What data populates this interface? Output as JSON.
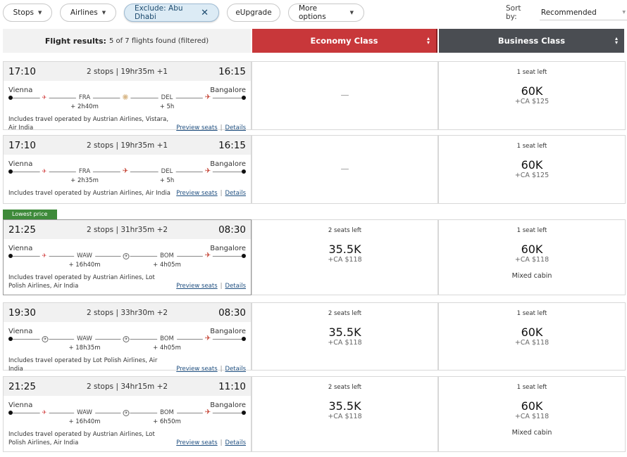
{
  "filters": {
    "stops": "Stops",
    "airlines": "Airlines",
    "exclude": "Exclude: Abu Dhabi",
    "eupgrade": "eUpgrade",
    "more": "More options"
  },
  "sort": {
    "label": "Sort by:",
    "value": "Recommended"
  },
  "header": {
    "results_label": "Flight results:",
    "results_text": "5 of 7 flights found (filtered)",
    "economy": "Economy Class",
    "business": "Business Class"
  },
  "links": {
    "preview": "Preview seats",
    "details": "Details",
    "sep": "|"
  },
  "lowest_badge": "Lowest price",
  "flights": [
    {
      "depart": "17:10",
      "summary": "2 stops | 19hr35m +1",
      "arrive": "16:15",
      "origin": "Vienna",
      "destination": "Bangalore",
      "stops": [
        {
          "code": "FRA",
          "layover": "+ 2h40m"
        },
        {
          "code": "DEL",
          "layover": "+ 5h"
        }
      ],
      "carriers": [
        "austrian-icon",
        "vistara-icon",
        "air-india-icon"
      ],
      "operated": "Includes travel operated by Austrian Airlines, Vistara, Air India",
      "economy": {
        "available": false,
        "dash": "—"
      },
      "business": {
        "seats": "1 seat left",
        "price": "60K",
        "tax": "+CA $125"
      }
    },
    {
      "depart": "17:10",
      "summary": "2 stops | 19hr35m +1",
      "arrive": "16:15",
      "origin": "Vienna",
      "destination": "Bangalore",
      "stops": [
        {
          "code": "FRA",
          "layover": "+ 2h35m"
        },
        {
          "code": "DEL",
          "layover": "+ 5h"
        }
      ],
      "carriers": [
        "austrian-icon",
        "air-india-icon",
        "air-india-icon"
      ],
      "operated": "Includes travel operated by Austrian Airlines, Air India",
      "economy": {
        "available": false,
        "dash": "—"
      },
      "business": {
        "seats": "1 seat left",
        "price": "60K",
        "tax": "+CA $125"
      }
    },
    {
      "depart": "21:25",
      "summary": "2 stops | 31hr35m +2",
      "arrive": "08:30",
      "origin": "Vienna",
      "destination": "Bangalore",
      "stops": [
        {
          "code": "WAW",
          "layover": "+ 16h40m"
        },
        {
          "code": "BOM",
          "layover": "+ 4h05m"
        }
      ],
      "carriers": [
        "austrian-icon",
        "lot-icon",
        "air-india-icon"
      ],
      "operated": "Includes travel operated by Austrian Airlines, Lot Polish Airlines, Air India",
      "economy": {
        "available": true,
        "seats": "2 seats left",
        "price": "35.5K",
        "tax": "+CA $118"
      },
      "business": {
        "seats": "1 seat left",
        "price": "60K",
        "tax": "+CA $118",
        "note": "Mixed cabin"
      }
    },
    {
      "depart": "19:30",
      "summary": "2 stops | 33hr30m +2",
      "arrive": "08:30",
      "origin": "Vienna",
      "destination": "Bangalore",
      "stops": [
        {
          "code": "WAW",
          "layover": "+ 18h35m"
        },
        {
          "code": "BOM",
          "layover": "+ 4h05m"
        }
      ],
      "carriers": [
        "lot-icon",
        "lot-icon",
        "air-india-icon"
      ],
      "operated": "Includes travel operated by Lot Polish Airlines, Air India",
      "economy": {
        "available": true,
        "seats": "2 seats left",
        "price": "35.5K",
        "tax": "+CA $118"
      },
      "business": {
        "seats": "1 seat left",
        "price": "60K",
        "tax": "+CA $118"
      }
    },
    {
      "depart": "21:25",
      "summary": "2 stops | 34hr15m +2",
      "arrive": "11:10",
      "origin": "Vienna",
      "destination": "Bangalore",
      "stops": [
        {
          "code": "WAW",
          "layover": "+ 16h40m"
        },
        {
          "code": "BOM",
          "layover": "+ 6h50m"
        }
      ],
      "carriers": [
        "austrian-icon",
        "lot-icon",
        "air-india-icon"
      ],
      "operated": "Includes travel operated by Austrian Airlines, Lot Polish Airlines, Air India",
      "economy": {
        "available": true,
        "seats": "2 seats left",
        "price": "35.5K",
        "tax": "+CA $118"
      },
      "business": {
        "seats": "1 seat left",
        "price": "60K",
        "tax": "+CA $118",
        "note": "Mixed cabin"
      }
    }
  ]
}
